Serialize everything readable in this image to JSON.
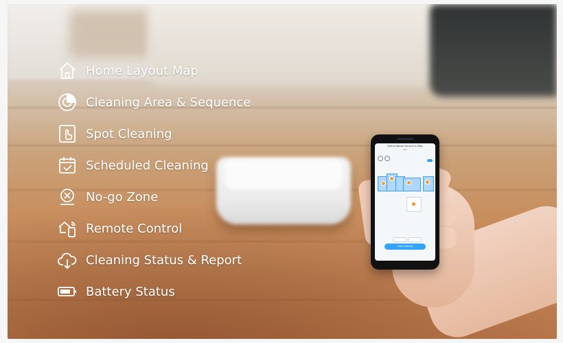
{
  "features": [
    {
      "label": "Home Layout Map",
      "icon": "home-icon"
    },
    {
      "label": "Cleaning Area & Sequence",
      "icon": "target-area-icon"
    },
    {
      "label": "Spot Cleaning",
      "icon": "spot-touch-icon"
    },
    {
      "label": "Scheduled Cleaning",
      "icon": "calendar-icon"
    },
    {
      "label": "No-go Zone",
      "icon": "no-go-zone-icon"
    },
    {
      "label": "Remote Control",
      "icon": "remote-control-icon"
    },
    {
      "label": "Cleaning Status & Report",
      "icon": "cloud-report-icon"
    },
    {
      "label": "Battery Status",
      "icon": "battery-icon"
    }
  ],
  "phone_screen": {
    "title": "Kamal Robot Vacuum & Mop",
    "subtitle": "Min",
    "button_label": "Start cleaning"
  },
  "colors": {
    "text": "#ffffff",
    "accent_blue": "#33a3ff",
    "map_room": "#aed8ff"
  }
}
